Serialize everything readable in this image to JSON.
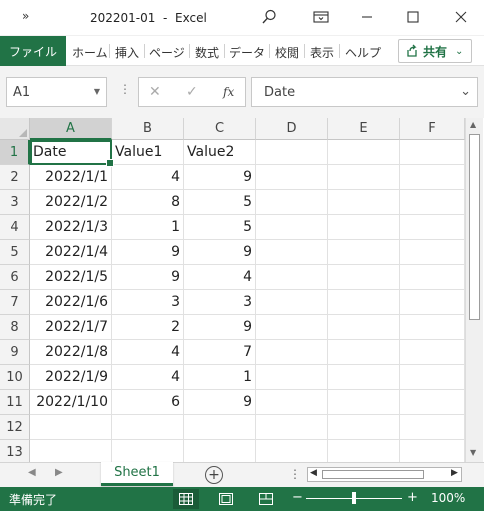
{
  "window": {
    "overflow_glyph": "»",
    "title": "202201-01  -  Excel",
    "icons": [
      "search-icon",
      "ribbon-display-icon",
      "minimize-icon",
      "maximize-icon",
      "close-icon"
    ]
  },
  "ribbon": {
    "file_tab": "ファイル",
    "tabs": [
      "ホーム",
      "挿入",
      "ページ",
      "数式",
      "データ",
      "校閲",
      "表示",
      "ヘルプ"
    ],
    "share_label": "共有",
    "accent_color": "#217346"
  },
  "formula_bar": {
    "name_box": "A1",
    "formula": "Date",
    "fx_label": "fx"
  },
  "sheet": {
    "columns": [
      "A",
      "B",
      "C",
      "D",
      "E",
      "F"
    ],
    "rows": [
      "1",
      "2",
      "3",
      "4",
      "5",
      "6",
      "7",
      "8",
      "9",
      "10",
      "11",
      "12",
      "13"
    ],
    "header": [
      "Date",
      "Value1",
      "Value2"
    ],
    "data": [
      [
        "2022/1/1",
        "4",
        "9"
      ],
      [
        "2022/1/2",
        "8",
        "5"
      ],
      [
        "2022/1/3",
        "1",
        "5"
      ],
      [
        "2022/1/4",
        "9",
        "9"
      ],
      [
        "2022/1/5",
        "9",
        "4"
      ],
      [
        "2022/1/6",
        "3",
        "3"
      ],
      [
        "2022/1/7",
        "2",
        "9"
      ],
      [
        "2022/1/8",
        "4",
        "7"
      ],
      [
        "2022/1/9",
        "4",
        "1"
      ],
      [
        "2022/1/10",
        "6",
        "9"
      ]
    ],
    "selected_cell": "A1"
  },
  "sheet_tabs": {
    "tabs": [
      "Sheet1"
    ],
    "active": "Sheet1"
  },
  "status": {
    "ready": "準備完了",
    "zoom": "100%"
  }
}
